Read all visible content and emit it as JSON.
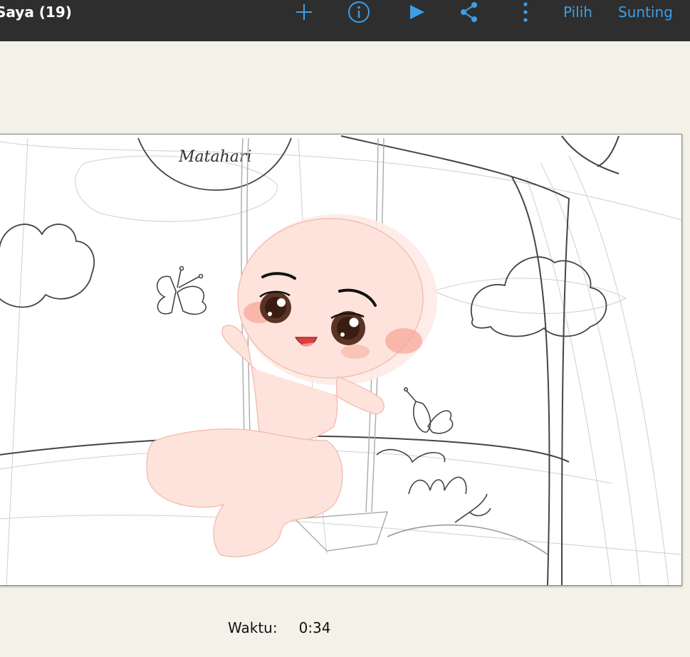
{
  "topbar": {
    "title": "Saya (19)",
    "icons": [
      "plus-icon",
      "info-icon",
      "play-icon",
      "share-icon",
      "more-vertical-icon"
    ],
    "select_label": "Pilih",
    "edit_label": "Sunting",
    "accent_color": "#3d9ee6",
    "bar_color": "#2e2e2e"
  },
  "canvas": {
    "sign_text": "Matahari"
  },
  "footer": {
    "time_label": "Waktu:",
    "time_value": "0:34"
  }
}
